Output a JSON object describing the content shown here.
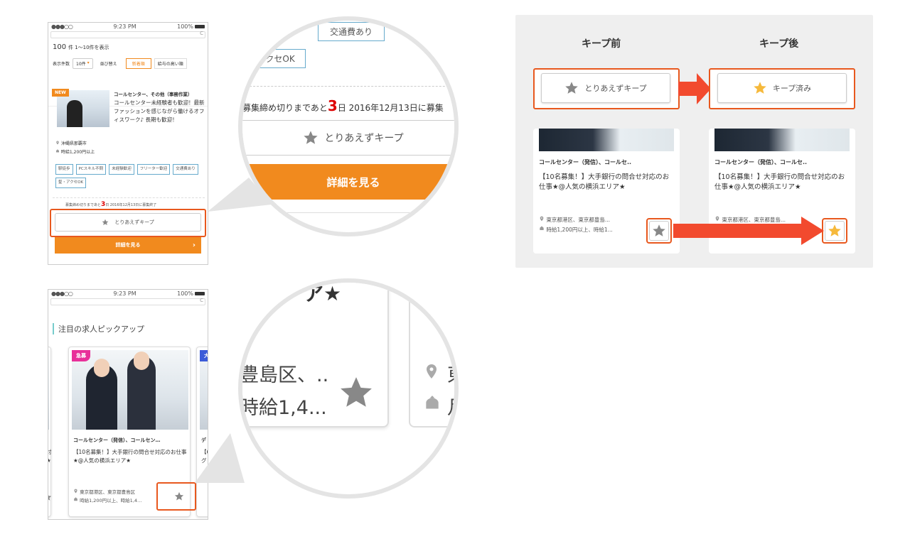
{
  "phone_status": {
    "carrier": "●●●○○",
    "time": "9:23 PM",
    "battery": "100%",
    "reload": "C"
  },
  "list_screen": {
    "count_number": "100",
    "count_text": "件  1〜10件を表示",
    "per_page_label": "表示件数",
    "per_page_value": "10件",
    "sort_label": "並び替え",
    "sort_new": "新着順",
    "sort_salary": "給与の高い順",
    "job": {
      "badge": "NEW",
      "title": "コールセンター、その他（事務作業）",
      "desc": "コールセンター未経験者も歓迎！最新ファッションを感じながら働けるオフィスワーク♪ 長期も歓迎！",
      "location": "沖縄県那覇市",
      "salary": "時給1,200円以上",
      "tags": [
        "駅徒歩",
        "PCスキル不問",
        "未経験歓迎",
        "フリーター歓迎",
        "交通費あり",
        "髪・アクセOK"
      ],
      "deadline_pre": "募集締め切りまであと",
      "deadline_days": "3",
      "deadline_post": "日 2016年12月13日に募集終了"
    },
    "keep_label": "とりあえずキープ",
    "detail_label": "詳細を見る",
    "detail_arrow": "›"
  },
  "zoom1": {
    "tag_transport": "交通費あり",
    "tag_accessory": "アクセOK",
    "deadline_pre": "募集締め切りまであと",
    "deadline_days": "3",
    "deadline_post": "日 2016年12月13日に募集",
    "keep_label": "とりあえずキープ",
    "detail_label": "詳細を見る"
  },
  "pickup_screen": {
    "heading": "注目の求人ピックアップ",
    "badge": "急募",
    "badge_next": "大",
    "title": "コールセンター（発信）、コールセン…",
    "desc": "【10名募集！】大手銀行の問合せ対応のお仕事★@人気の横浜エリア★",
    "location": "東京都港区、東京都豊島区",
    "salary": "時給1,200円以上、時給1,4…",
    "next_title": "デ",
    "next_desc": "【6\nグ",
    "prev_desc": "対\n★"
  },
  "zoom2": {
    "top_text": "ア★",
    "location": "豊島区、..",
    "salary": "時給1,4..."
  },
  "comparison": {
    "before_label": "キープ前",
    "after_label": "キープ後",
    "before_button": "とりあえずキープ",
    "after_button": "キープ済み",
    "card_title": "コールセンター（発信）、コールセ..",
    "card_desc": "【10名募集！】大手銀行の問合せ対応のお仕事★@人気の横浜エリア★",
    "before_location": "東京都港区、東京都豊島...",
    "before_salary": "時給1,200円以上、時給1...",
    "after_location": "東京都港区、東京都豊島..."
  },
  "colors": {
    "accent": "#f18a1e",
    "highlight": "#e8581e",
    "arrow": "#f24a2e",
    "star_gray": "#888888",
    "star_gold": "#f6b93b",
    "tag_border": "#66aacc"
  },
  "icons": [
    "star-icon",
    "pin-icon",
    "wallet-icon",
    "reload-icon",
    "wifi-icon",
    "battery-icon"
  ]
}
